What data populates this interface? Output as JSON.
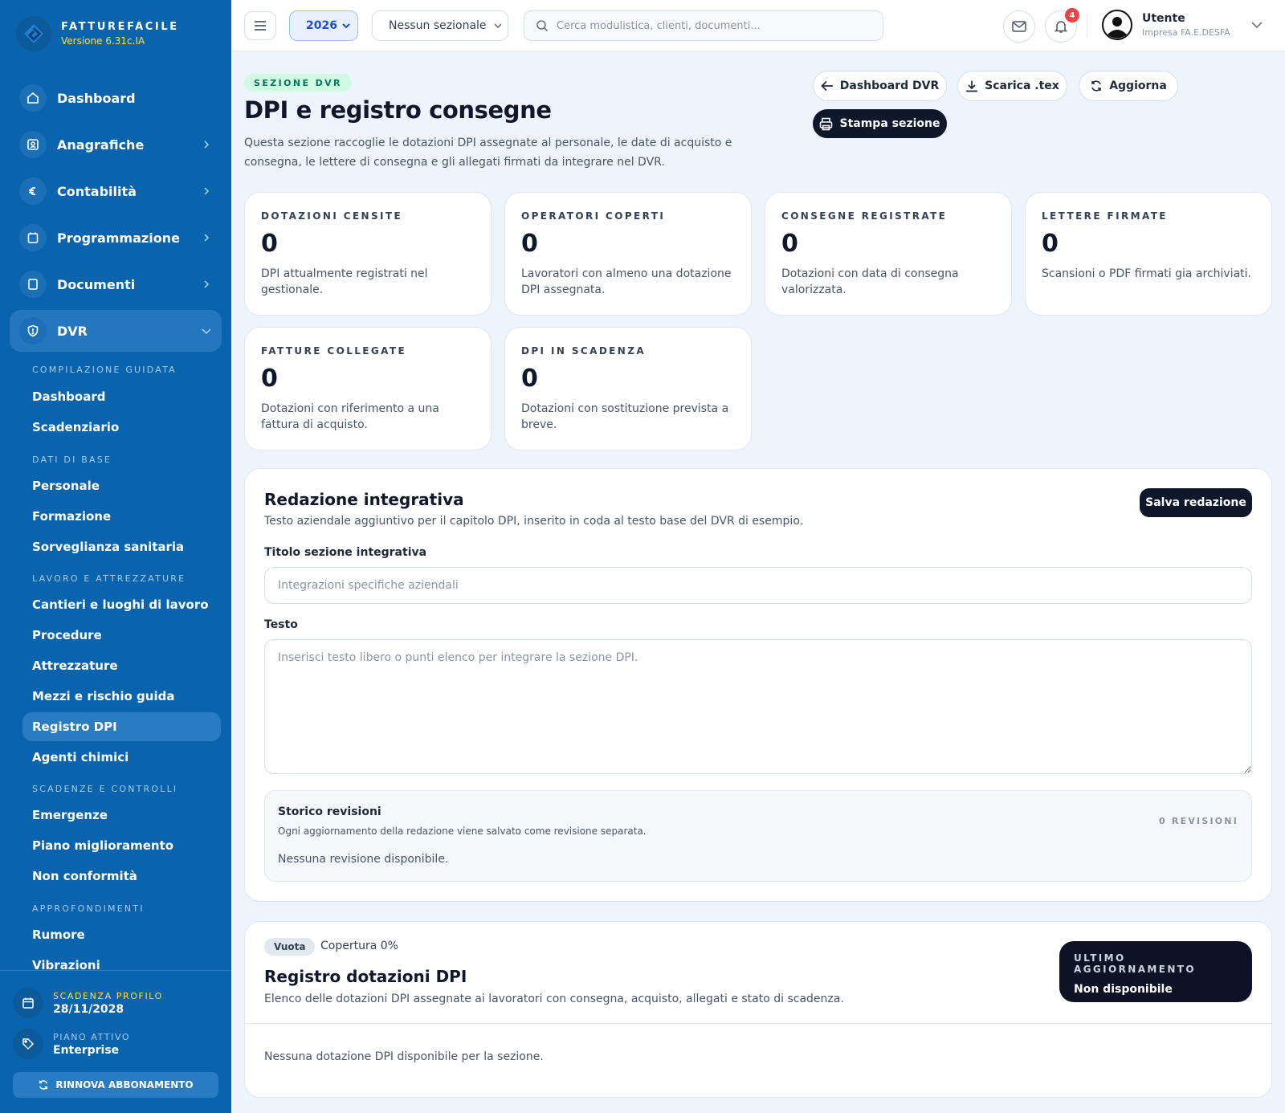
{
  "brand": {
    "name": "FATTUREFACILE",
    "version": "Versione 6.31c.IA"
  },
  "nav": {
    "main": [
      {
        "label": "Dashboard",
        "icon": "home-icon",
        "chevron": false
      },
      {
        "label": "Anagrafiche",
        "icon": "contacts-icon",
        "chevron": true
      },
      {
        "label": "Contabilità",
        "icon": "euro-icon",
        "chevron": true
      },
      {
        "label": "Programmazione",
        "icon": "calendar-icon",
        "chevron": true
      },
      {
        "label": "Documenti",
        "icon": "document-icon",
        "chevron": true
      },
      {
        "label": "DVR",
        "icon": "shield-icon",
        "chevron": true,
        "expanded": true
      }
    ],
    "groups": [
      {
        "title": "COMPILAZIONE GUIDATA",
        "items": [
          "Dashboard",
          "Scadenziario"
        ]
      },
      {
        "title": "DATI DI BASE",
        "items": [
          "Personale",
          "Formazione",
          "Sorveglianza sanitaria"
        ]
      },
      {
        "title": "LAVORO E ATTREZZATURE",
        "items": [
          "Cantieri e luoghi di lavoro",
          "Procedure",
          "Attrezzature",
          "Mezzi e rischio guida",
          "Registro DPI",
          "Agenti chimici"
        ]
      },
      {
        "title": "SCADENZE E CONTROLLI",
        "items": [
          "Emergenze",
          "Piano miglioramento",
          "Non conformità"
        ]
      },
      {
        "title": "APPROFONDIMENTI",
        "items": [
          "Rumore",
          "Vibrazioni"
        ]
      }
    ],
    "active_item": "Registro DPI"
  },
  "sidebar_footer": {
    "expiry_label": "SCADENZA PROFILO",
    "expiry_value": "28/11/2028",
    "plan_label": "PIANO ATTIVO",
    "plan_value": "Enterprise",
    "renew_label": "RINNOVA ABBONAMENTO"
  },
  "topbar": {
    "year": "2026",
    "sezionale": "Nessun sezionale",
    "search_placeholder": "Cerca modulistica, clienti, documenti...",
    "notifications_count": "4",
    "user_name": "Utente",
    "user_company": "Impresa FA.E.DESFA"
  },
  "header": {
    "section_pill": "SEZIONE DVR",
    "title": "DPI e registro consegne",
    "description": "Questa sezione raccoglie le dotazioni DPI assegnate al personale, le date di acquisto e consegna, le lettere di consegna e gli allegati firmati da integrare nel DVR.",
    "btn_dashboard": "Dashboard DVR",
    "btn_download": "Scarica .tex",
    "btn_refresh": "Aggiorna",
    "btn_print": "Stampa sezione"
  },
  "stats": [
    {
      "label": "DOTAZIONI CENSITE",
      "value": "0",
      "desc": "DPI attualmente registrati nel gestionale."
    },
    {
      "label": "OPERATORI COPERTI",
      "value": "0",
      "desc": "Lavoratori con almeno una dotazione DPI assegnata."
    },
    {
      "label": "CONSEGNE REGISTRATE",
      "value": "0",
      "desc": "Dotazioni con data di consegna valorizzata."
    },
    {
      "label": "LETTERE FIRMATE",
      "value": "0",
      "desc": "Scansioni o PDF firmati gia archiviati."
    },
    {
      "label": "FATTURE COLLEGATE",
      "value": "0",
      "desc": "Dotazioni con riferimento a una fattura di acquisto."
    },
    {
      "label": "DPI IN SCADENZA",
      "value": "0",
      "desc": "Dotazioni con sostituzione prevista a breve."
    }
  ],
  "redazione": {
    "title": "Redazione integrativa",
    "subtitle": "Testo aziendale aggiuntivo per il capitolo DPI, inserito in coda al testo base del DVR di esempio.",
    "save_label": "Salva redazione",
    "title_label": "Titolo sezione integrativa",
    "title_placeholder": "Integrazioni specifiche aziendali",
    "title_value": "",
    "text_label": "Testo",
    "text_placeholder": "Inserisci testo libero o punti elenco per integrare la sezione DPI.",
    "text_value": "",
    "history_title": "Storico revisioni",
    "history_desc": "Ogni aggiornamento della redazione viene salvato come revisione separata.",
    "history_count": "0 REVISIONI",
    "history_empty": "Nessuna revisione disponibile."
  },
  "registro": {
    "status_tag": "Vuota",
    "coverage": "Copertura 0%",
    "title": "Registro dotazioni DPI",
    "subtitle": "Elenco delle dotazioni DPI assegnate ai lavoratori con consegna, acquisto, allegati e stato di scadenza.",
    "update_label": "ULTIMO AGGIORNAMENTO",
    "update_value": "Non disponibile",
    "empty": "Nessuna dotazione DPI disponibile per la sezione."
  },
  "colors": {
    "sidebar": "#0a64ad",
    "accent_yellow": "#fde047",
    "dark_button": "#0f172a",
    "pill_green_bg": "#d1fae5",
    "pill_green_text": "#047857",
    "badge_red": "#ef4444"
  }
}
